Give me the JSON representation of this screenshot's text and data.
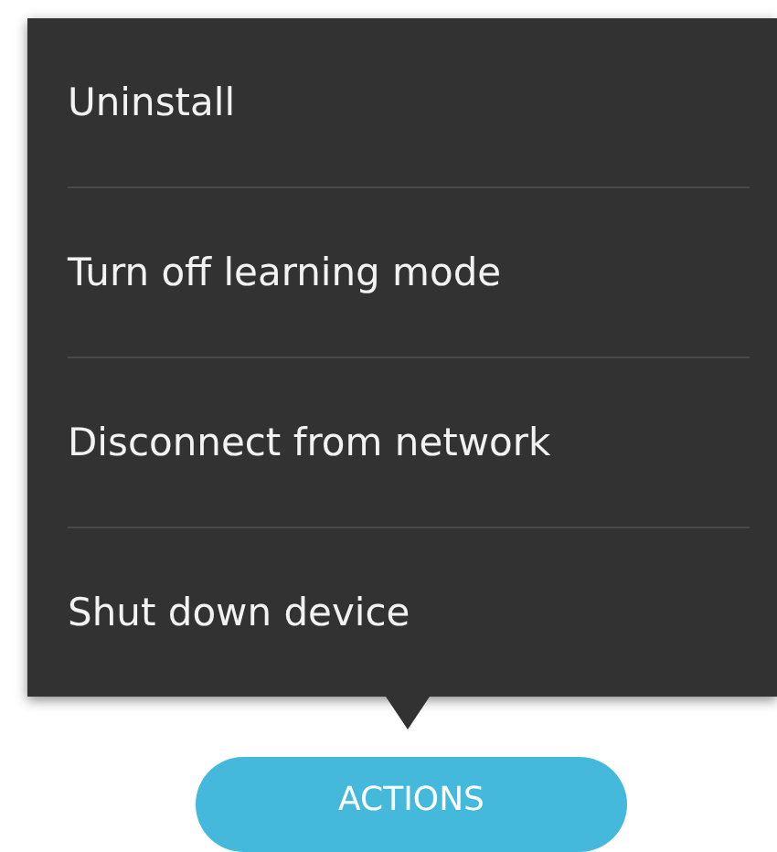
{
  "menu": {
    "items": [
      {
        "label": "Uninstall"
      },
      {
        "label": "Turn off learning mode"
      },
      {
        "label": "Disconnect from network"
      },
      {
        "label": "Shut down device"
      }
    ]
  },
  "actions_button": {
    "label": "ACTIONS"
  }
}
